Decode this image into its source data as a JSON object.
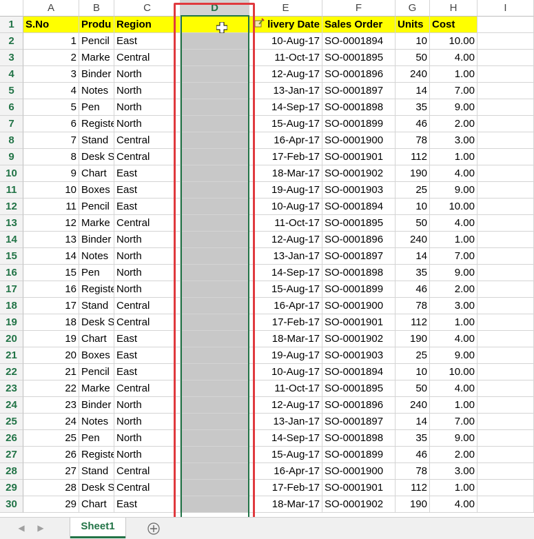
{
  "columns": [
    "A",
    "B",
    "C",
    "D",
    "E",
    "F",
    "G",
    "H",
    "I"
  ],
  "header_row": {
    "row_num": "1",
    "cells": [
      "S.No",
      "Produ",
      "Region",
      "",
      "livery Date",
      "Sales Order",
      "Units",
      "Cost",
      ""
    ]
  },
  "rows": [
    {
      "n": "2",
      "sno": "1",
      "product": "Pencil",
      "region": "East",
      "date": "10-Aug-17",
      "order": "SO-0001894",
      "units": "10",
      "cost": "10.00"
    },
    {
      "n": "3",
      "sno": "2",
      "product": "Marke",
      "region": "Central",
      "date": "11-Oct-17",
      "order": "SO-0001895",
      "units": "50",
      "cost": "4.00"
    },
    {
      "n": "4",
      "sno": "3",
      "product": "Binder",
      "region": "North",
      "date": "12-Aug-17",
      "order": "SO-0001896",
      "units": "240",
      "cost": "1.00"
    },
    {
      "n": "5",
      "sno": "4",
      "product": "Notes",
      "region": "North",
      "date": "13-Jan-17",
      "order": "SO-0001897",
      "units": "14",
      "cost": "7.00"
    },
    {
      "n": "6",
      "sno": "5",
      "product": "Pen",
      "region": "North",
      "date": "14-Sep-17",
      "order": "SO-0001898",
      "units": "35",
      "cost": "9.00"
    },
    {
      "n": "7",
      "sno": "6",
      "product": "Registe",
      "region": "North",
      "date": "15-Aug-17",
      "order": "SO-0001899",
      "units": "46",
      "cost": "2.00"
    },
    {
      "n": "8",
      "sno": "7",
      "product": "Stand",
      "region": "Central",
      "date": "16-Apr-17",
      "order": "SO-0001900",
      "units": "78",
      "cost": "3.00"
    },
    {
      "n": "9",
      "sno": "8",
      "product": "Desk S",
      "region": "Central",
      "date": "17-Feb-17",
      "order": "SO-0001901",
      "units": "112",
      "cost": "1.00"
    },
    {
      "n": "10",
      "sno": "9",
      "product": "Chart",
      "region": "East",
      "date": "18-Mar-17",
      "order": "SO-0001902",
      "units": "190",
      "cost": "4.00"
    },
    {
      "n": "11",
      "sno": "10",
      "product": "Boxes",
      "region": "East",
      "date": "19-Aug-17",
      "order": "SO-0001903",
      "units": "25",
      "cost": "9.00"
    },
    {
      "n": "12",
      "sno": "11",
      "product": "Pencil",
      "region": "East",
      "date": "10-Aug-17",
      "order": "SO-0001894",
      "units": "10",
      "cost": "10.00"
    },
    {
      "n": "13",
      "sno": "12",
      "product": "Marke",
      "region": "Central",
      "date": "11-Oct-17",
      "order": "SO-0001895",
      "units": "50",
      "cost": "4.00"
    },
    {
      "n": "14",
      "sno": "13",
      "product": "Binder",
      "region": "North",
      "date": "12-Aug-17",
      "order": "SO-0001896",
      "units": "240",
      "cost": "1.00"
    },
    {
      "n": "15",
      "sno": "14",
      "product": "Notes",
      "region": "North",
      "date": "13-Jan-17",
      "order": "SO-0001897",
      "units": "14",
      "cost": "7.00"
    },
    {
      "n": "16",
      "sno": "15",
      "product": "Pen",
      "region": "North",
      "date": "14-Sep-17",
      "order": "SO-0001898",
      "units": "35",
      "cost": "9.00"
    },
    {
      "n": "17",
      "sno": "16",
      "product": "Registe",
      "region": "North",
      "date": "15-Aug-17",
      "order": "SO-0001899",
      "units": "46",
      "cost": "2.00"
    },
    {
      "n": "18",
      "sno": "17",
      "product": "Stand",
      "region": "Central",
      "date": "16-Apr-17",
      "order": "SO-0001900",
      "units": "78",
      "cost": "3.00"
    },
    {
      "n": "19",
      "sno": "18",
      "product": "Desk S",
      "region": "Central",
      "date": "17-Feb-17",
      "order": "SO-0001901",
      "units": "112",
      "cost": "1.00"
    },
    {
      "n": "20",
      "sno": "19",
      "product": "Chart",
      "region": "East",
      "date": "18-Mar-17",
      "order": "SO-0001902",
      "units": "190",
      "cost": "4.00"
    },
    {
      "n": "21",
      "sno": "20",
      "product": "Boxes",
      "region": "East",
      "date": "19-Aug-17",
      "order": "SO-0001903",
      "units": "25",
      "cost": "9.00"
    },
    {
      "n": "22",
      "sno": "21",
      "product": "Pencil",
      "region": "East",
      "date": "10-Aug-17",
      "order": "SO-0001894",
      "units": "10",
      "cost": "10.00"
    },
    {
      "n": "23",
      "sno": "22",
      "product": "Marke",
      "region": "Central",
      "date": "11-Oct-17",
      "order": "SO-0001895",
      "units": "50",
      "cost": "4.00"
    },
    {
      "n": "24",
      "sno": "23",
      "product": "Binder",
      "region": "North",
      "date": "12-Aug-17",
      "order": "SO-0001896",
      "units": "240",
      "cost": "1.00"
    },
    {
      "n": "25",
      "sno": "24",
      "product": "Notes",
      "region": "North",
      "date": "13-Jan-17",
      "order": "SO-0001897",
      "units": "14",
      "cost": "7.00"
    },
    {
      "n": "26",
      "sno": "25",
      "product": "Pen",
      "region": "North",
      "date": "14-Sep-17",
      "order": "SO-0001898",
      "units": "35",
      "cost": "9.00"
    },
    {
      "n": "27",
      "sno": "26",
      "product": "Registe",
      "region": "North",
      "date": "15-Aug-17",
      "order": "SO-0001899",
      "units": "46",
      "cost": "2.00"
    },
    {
      "n": "28",
      "sno": "27",
      "product": "Stand",
      "region": "Central",
      "date": "16-Apr-17",
      "order": "SO-0001900",
      "units": "78",
      "cost": "3.00"
    },
    {
      "n": "29",
      "sno": "28",
      "product": "Desk S",
      "region": "Central",
      "date": "17-Feb-17",
      "order": "SO-0001901",
      "units": "112",
      "cost": "1.00"
    },
    {
      "n": "30",
      "sno": "29",
      "product": "Chart",
      "region": "East",
      "date": "18-Mar-17",
      "order": "SO-0001902",
      "units": "190",
      "cost": "4.00"
    }
  ],
  "selected_column": "D",
  "sheet_tab": "Sheet1",
  "colors": {
    "header_fill": "#ffff00",
    "excel_green": "#217346",
    "selection_gray": "#c8c8c8",
    "highlight_red": "#e0393e"
  },
  "icons": {
    "cursor": "crosshair-plus-icon",
    "paste_options": "paste-options-icon",
    "add_sheet": "plus-circle-icon",
    "nav_prev": "chevron-left-icon",
    "nav_next": "chevron-right-icon"
  }
}
